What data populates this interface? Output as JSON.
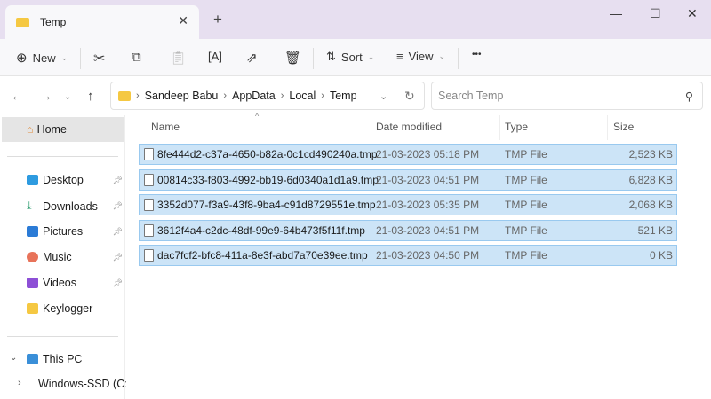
{
  "window": {
    "tab_title": "Temp",
    "new_tab": "+",
    "minimize": "—",
    "maximize": "☐",
    "close": "✕"
  },
  "toolbar": {
    "new_label": "New",
    "sort_label": "Sort",
    "view_label": "View",
    "more": "•••"
  },
  "address": {
    "crumbs": [
      "Sandeep Babu",
      "AppData",
      "Local",
      "Temp"
    ]
  },
  "search": {
    "placeholder": "Search Temp"
  },
  "sidebar": {
    "home": "Home",
    "quick": [
      {
        "label": "Desktop",
        "color": "#2e9be0"
      },
      {
        "label": "Downloads",
        "color": "#2a9c6e"
      },
      {
        "label": "Pictures",
        "color": "#2b7bd6"
      },
      {
        "label": "Music",
        "color": "#e8735a"
      },
      {
        "label": "Videos",
        "color": "#8d4fd6"
      },
      {
        "label": "Keylogger",
        "color": "#f5c842"
      }
    ],
    "this_pc": "This PC",
    "drive": "Windows-SSD (C:)"
  },
  "columns": {
    "name": "Name",
    "date": "Date modified",
    "type": "Type",
    "size": "Size"
  },
  "files": [
    {
      "name": "8fe444d2-c37a-4650-b82a-0c1cd490240a.tmp",
      "date": "21-03-2023 05:18 PM",
      "type": "TMP File",
      "size": "2,523 KB"
    },
    {
      "name": "00814c33-f803-4992-bb19-6d0340a1d1a9.tmp",
      "date": "21-03-2023 04:51 PM",
      "type": "TMP File",
      "size": "6,828 KB"
    },
    {
      "name": "3352d077-f3a9-43f8-9ba4-c91d8729551e.tmp",
      "date": "21-03-2023 05:35 PM",
      "type": "TMP File",
      "size": "2,068 KB"
    },
    {
      "name": "3612f4a4-c2dc-48df-99e9-64b473f5f11f.tmp",
      "date": "21-03-2023 04:51 PM",
      "type": "TMP File",
      "size": "521 KB"
    },
    {
      "name": "dac7fcf2-bfc8-411a-8e3f-abd7a70e39ee.tmp",
      "date": "21-03-2023 04:50 PM",
      "type": "TMP File",
      "size": "0 KB"
    }
  ],
  "colors": {
    "selection": "#cce4f7",
    "titlebar": "#e7dff0"
  }
}
